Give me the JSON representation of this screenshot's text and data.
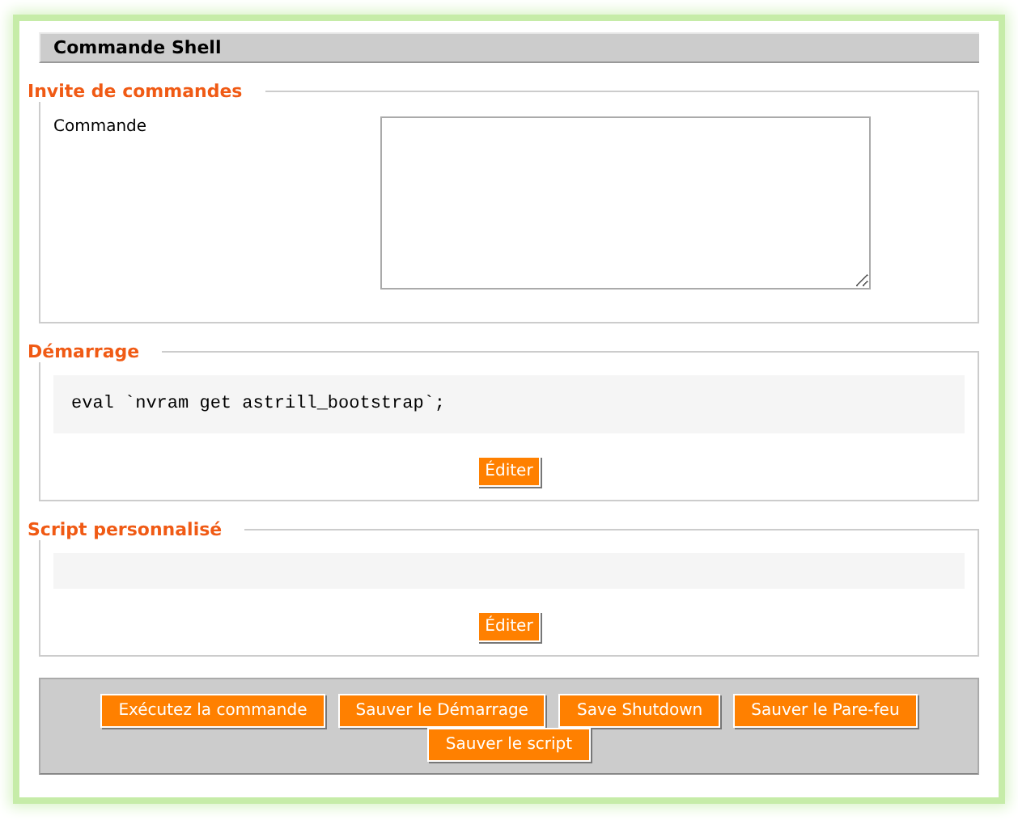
{
  "title": "Commande Shell",
  "sections": [
    {
      "kind": "command",
      "legend": "Invite de commandes",
      "label": "Commande"
    },
    {
      "kind": "script",
      "legend": "Démarrage",
      "code": "eval `nvram get astrill_bootstrap`;",
      "button": "Éditer"
    },
    {
      "kind": "script",
      "legend": "Script personnalisé",
      "button": "Éditer"
    }
  ],
  "buttons": [
    "Exécutez la commande",
    "Sauver le Démarrage",
    "Save Shutdown",
    "Sauver le Pare-feu",
    "Sauver le script"
  ]
}
